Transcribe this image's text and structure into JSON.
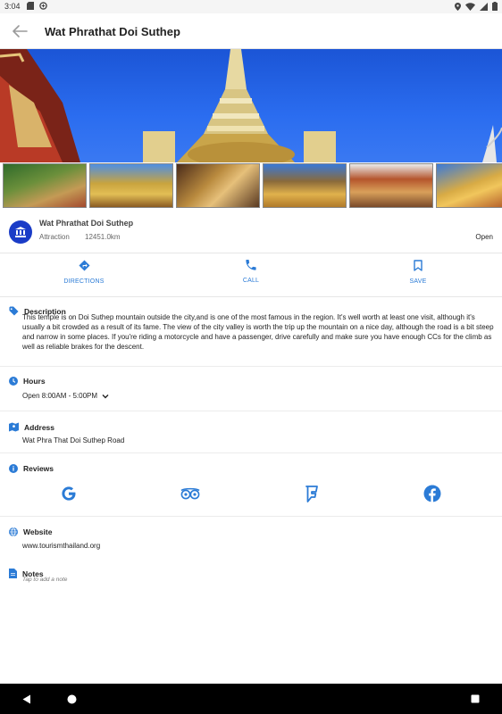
{
  "status_bar": {
    "time": "3:04",
    "left_icons": [
      "sd-card-icon",
      "sync-icon"
    ],
    "right_icons": [
      "location-icon",
      "wifi-icon",
      "signal-icon",
      "battery-icon"
    ]
  },
  "app_bar": {
    "title": "Wat Phrathat Doi Suthep",
    "back_icon": "arrow-back-icon"
  },
  "gallery": {
    "thumbnail_count": 6
  },
  "place": {
    "name": "Wat Phrathat Doi Suthep",
    "type": "Attraction",
    "distance": "12451.0km",
    "status": "Open",
    "logo_icon": "temple-icon"
  },
  "actions": {
    "directions": "DIRECTIONS",
    "call": "CALL",
    "save": "SAVE"
  },
  "description": {
    "title": "Description",
    "text": "This temple is on Doi Suthep mountain outside the city,and is one of the most famous in the region. It's well worth at least one visit, although it's usually a bit crowded as a result of its fame. The view of the city valley is worth the trip up the mountain on a nice day, although the road is a bit steep and narrow in some places. If you're riding a motorcycle and have a passenger, drive carefully and make sure you have enough CCs for the climb as well as reliable brakes for the descent."
  },
  "hours": {
    "title": "Hours",
    "value": "Open 8:00AM - 5:00PM"
  },
  "address": {
    "title": "Address",
    "value": "Wat Phra That Doi Suthep Road"
  },
  "reviews": {
    "title": "Reviews",
    "providers": [
      "google-icon",
      "tripadvisor-icon",
      "foursquare-icon",
      "facebook-icon"
    ]
  },
  "website": {
    "title": "Website",
    "value": "www.tourismthailand.org"
  },
  "notes": {
    "title": "Notes",
    "placeholder": "Tap to add a note"
  },
  "colors": {
    "accent": "#2b7bd6",
    "logo_bg": "#1a3cc7",
    "facebook": "#1877f2"
  }
}
